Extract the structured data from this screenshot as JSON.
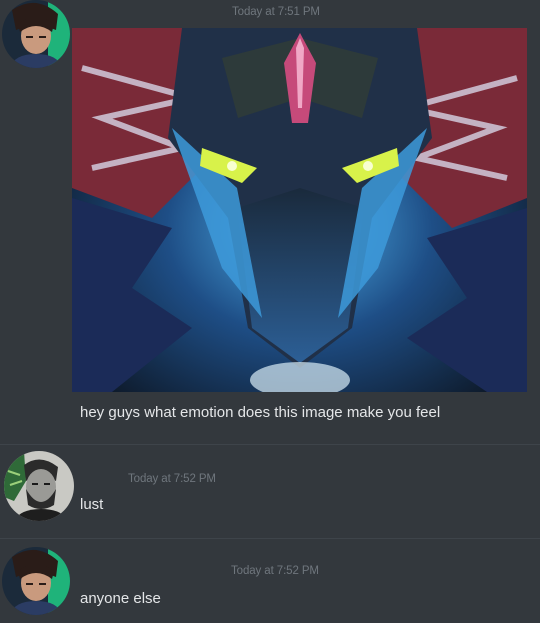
{
  "messages": [
    {
      "author": "user-a",
      "timestamp": "Today at 7:51 PM",
      "text": "hey guys what emotion does this image make you feel",
      "attachment_icon": "dragon-illustration-image"
    },
    {
      "author": "user-b",
      "timestamp": "Today at 7:52 PM",
      "text": "lust"
    },
    {
      "author": "user-a",
      "timestamp": "Today at 7:52 PM",
      "text": "anyone else"
    }
  ],
  "colors": {
    "background": "#33383d",
    "divider": "#3e444a",
    "timestamp": "#6f767d",
    "text": "#e4e6e8",
    "avatar_glow": "#22d38a"
  }
}
